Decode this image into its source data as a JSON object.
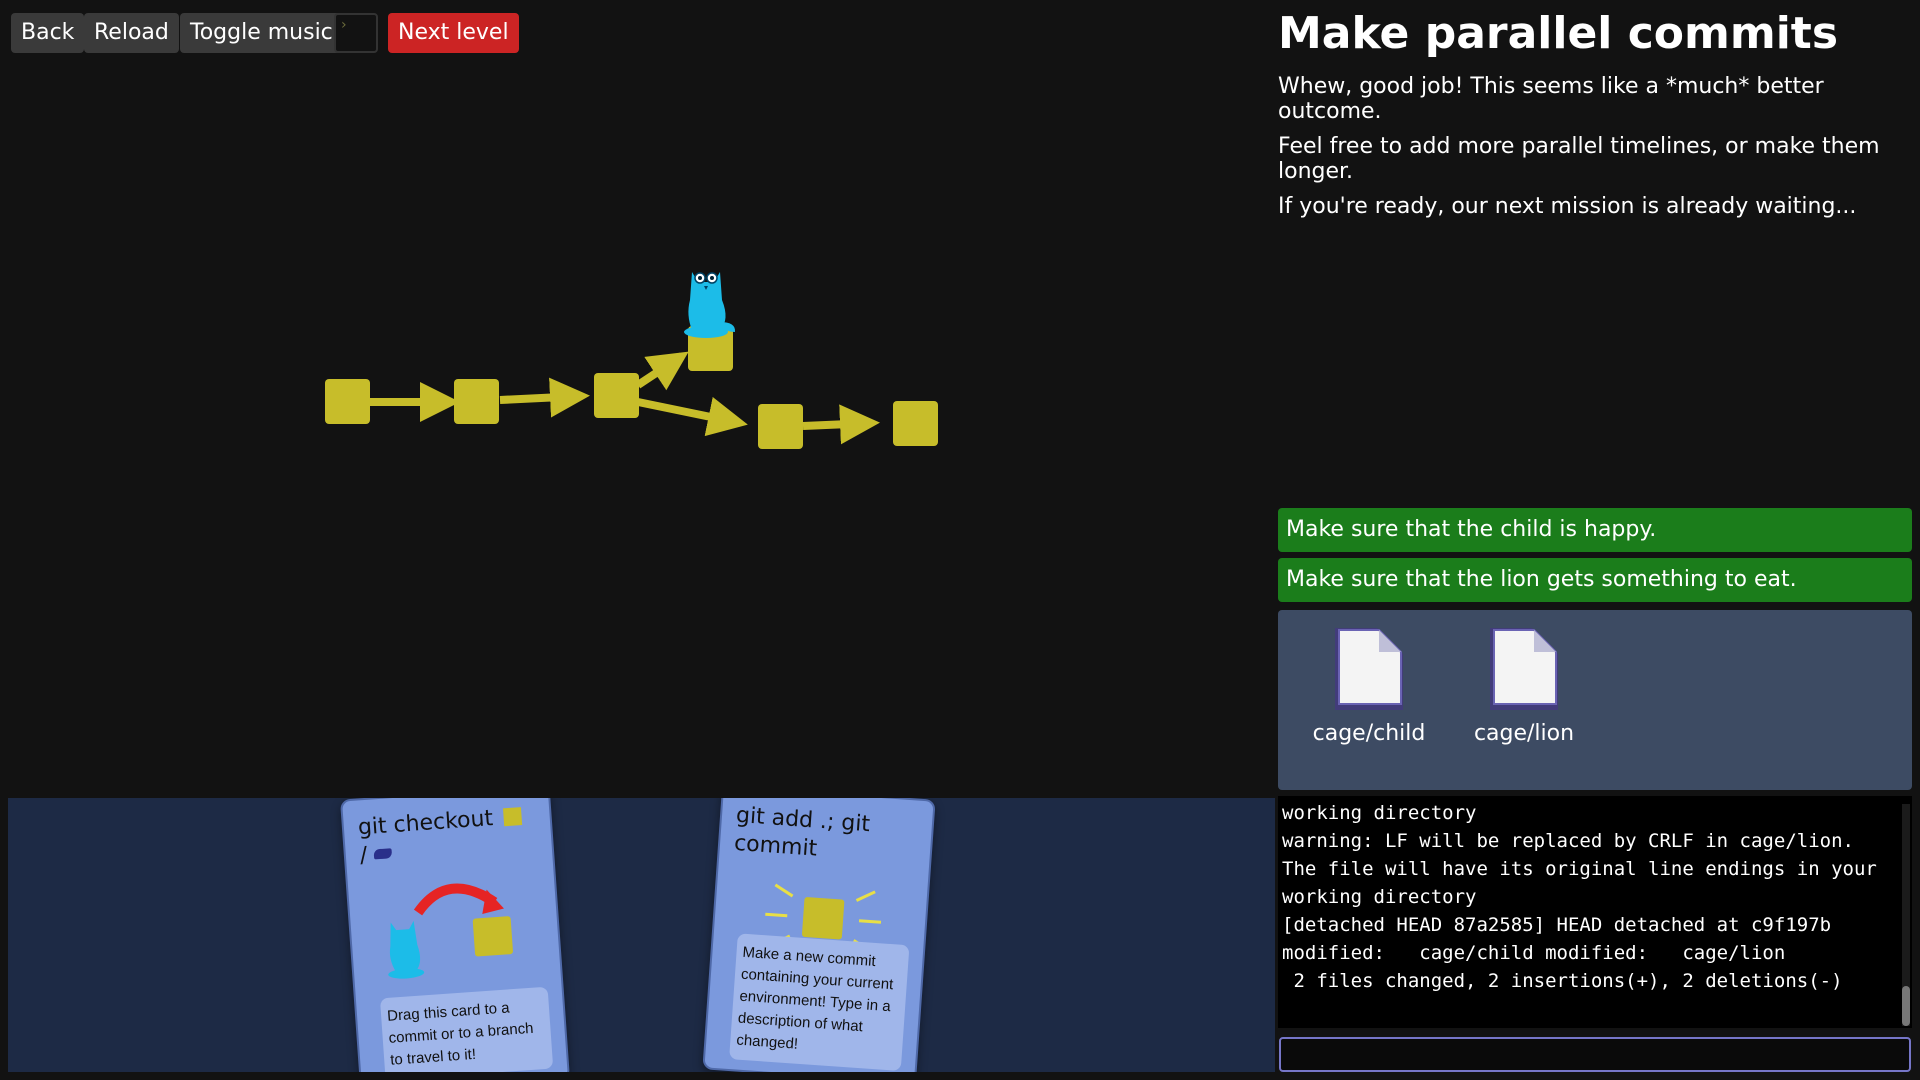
{
  "toolbar": {
    "back": "Back",
    "reload": "Reload",
    "toggle_music": "Toggle music",
    "terminal_icon": "terminal-icon",
    "next_level": "Next level"
  },
  "level": {
    "title": "Make parallel commits",
    "description": [
      "Whew, good job! This seems like a *much* better outcome.",
      "Feel free to add more parallel timelines, or make them longer.",
      "If you're ready, our next mission is already waiting..."
    ]
  },
  "goals": [
    "Make sure that the child is happy.",
    "Make sure that the lion gets something to eat."
  ],
  "files": [
    "cage/child",
    "cage/lion"
  ],
  "cards": [
    {
      "title": "git checkout",
      "title_suffix": "/",
      "description": "Drag this card to a commit or to a branch to travel to it!",
      "icons": [
        "commit-icon",
        "branch-icon"
      ]
    },
    {
      "title": "git add .; git commit",
      "description": "Make a new commit containing your current environment! Type in a description of what changed!",
      "icons": [
        "new-commit-icon"
      ]
    }
  ],
  "terminal": {
    "lines": [
      "working directory",
      "warning: LF will be replaced by CRLF in cage/lion.",
      "The file will have its original line endings in your",
      "working directory",
      "[detached HEAD 87a2585] HEAD detached at c9f197b",
      "modified:   cage/child modified:   cage/lion",
      " 2 files changed, 2 insertions(+), 2 deletions(-)"
    ],
    "input_value": ""
  },
  "colors": {
    "background": "#121212",
    "commit": "#c7bd2a",
    "head_owl": "#1cbce8",
    "goal_complete": "#1b7d1b",
    "card": "#7b99dd",
    "next_level": "#cc2424"
  }
}
